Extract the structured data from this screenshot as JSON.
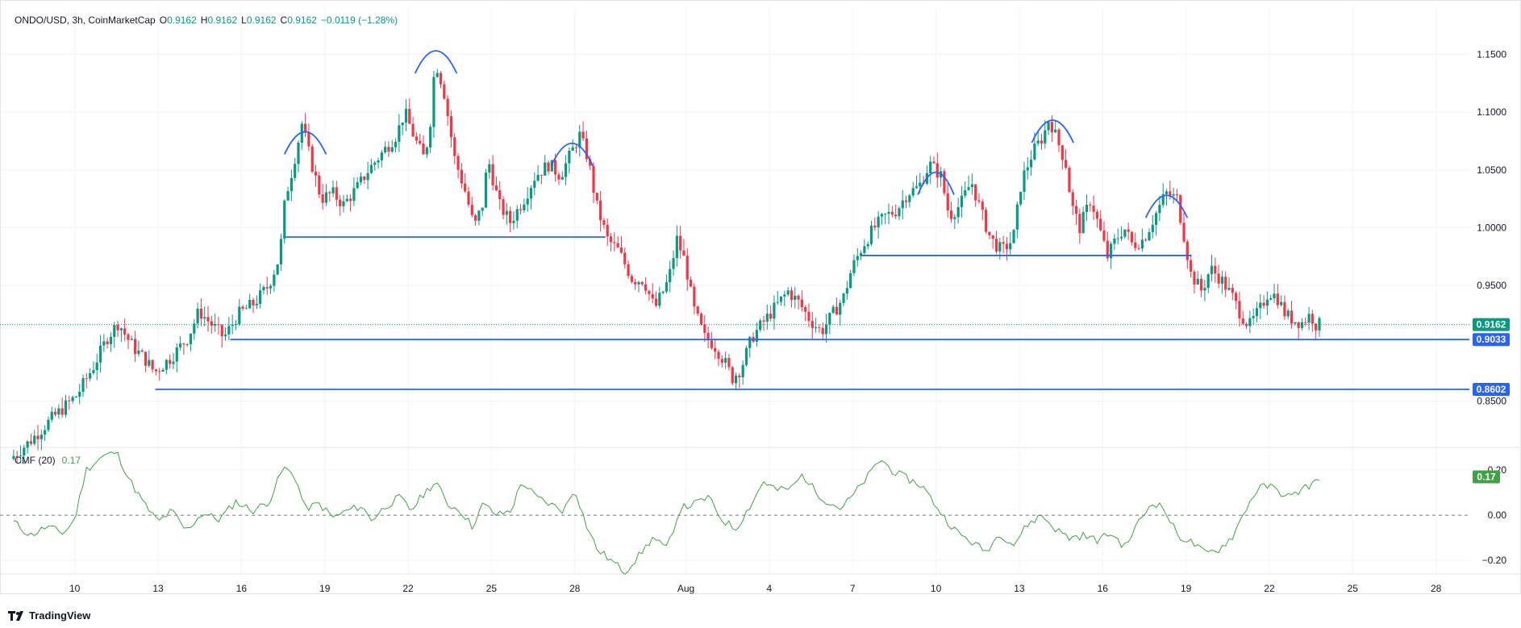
{
  "header": {
    "symbol": "ONDO/USD, 3h, CoinMarketCap",
    "o_label": "O",
    "o_value": "0.9162",
    "h_label": "H",
    "h_value": "0.9162",
    "l_label": "L",
    "l_value": "0.9162",
    "c_label": "C",
    "c_value": "0.9162",
    "change": "−0.0119 (−1.28%)"
  },
  "indicator": {
    "name": "CMF (20)",
    "value": "0.17"
  },
  "brand": "TradingView",
  "colors": {
    "up": "#089981",
    "down": "#f23645",
    "level": "#2962ff",
    "arc": "#2962ff",
    "cmf": "#43a047",
    "price_line": "#089981"
  },
  "chart_data": [
    {
      "type": "candlestick",
      "title": "ONDO/USD, 3h, CoinMarketCap",
      "x_tick_labels": [
        "10",
        "13",
        "16",
        "19",
        "22",
        "25",
        "28",
        "Aug",
        "4",
        "7",
        "10",
        "13",
        "16",
        "19",
        "22",
        "25",
        "28"
      ],
      "x_tick_days": [
        10,
        13,
        16,
        19,
        22,
        25,
        28,
        32,
        35,
        38,
        41,
        44,
        47,
        50,
        53,
        56,
        59
      ],
      "x_range_days": [
        7.6,
        60.2
      ],
      "y_tick_labels": [
        "0.8500",
        "0.9500",
        "1.0000",
        "1.0500",
        "1.1000",
        "1.1500"
      ],
      "y_range": [
        0.81,
        1.19
      ],
      "grid": true,
      "last_price": "0.9162",
      "price_path": [
        [
          7.8,
          0.8
        ],
        [
          8.5,
          0.815
        ],
        [
          9.3,
          0.835
        ],
        [
          10.2,
          0.855
        ],
        [
          10.8,
          0.88
        ],
        [
          11.3,
          0.905
        ],
        [
          11.7,
          0.918
        ],
        [
          12.0,
          0.905
        ],
        [
          12.3,
          0.895
        ],
        [
          12.7,
          0.885
        ],
        [
          13.0,
          0.875
        ],
        [
          13.6,
          0.888
        ],
        [
          14.2,
          0.905
        ],
        [
          14.6,
          0.928
        ],
        [
          15.1,
          0.915
        ],
        [
          15.5,
          0.905
        ],
        [
          16.0,
          0.925
        ],
        [
          16.6,
          0.935
        ],
        [
          17.1,
          0.95
        ],
        [
          17.5,
          0.975
        ],
        [
          17.7,
          1.025
        ],
        [
          18.0,
          1.055
        ],
        [
          18.3,
          1.09
        ],
        [
          18.6,
          1.06
        ],
        [
          19.0,
          1.025
        ],
        [
          19.4,
          1.03
        ],
        [
          19.8,
          1.02
        ],
        [
          20.3,
          1.035
        ],
        [
          20.7,
          1.05
        ],
        [
          21.2,
          1.065
        ],
        [
          21.7,
          1.08
        ],
        [
          22.0,
          1.1
        ],
        [
          22.4,
          1.075
        ],
        [
          22.7,
          1.06
        ],
        [
          22.9,
          1.085
        ],
        [
          23.1,
          1.145
        ],
        [
          23.4,
          1.12
        ],
        [
          23.8,
          1.06
        ],
        [
          24.2,
          1.03
        ],
        [
          24.5,
          1.0
        ],
        [
          24.8,
          1.02
        ],
        [
          25.0,
          1.06
        ],
        [
          25.4,
          1.02
        ],
        [
          25.8,
          1.005
        ],
        [
          26.3,
          1.025
        ],
        [
          26.7,
          1.045
        ],
        [
          27.2,
          1.055
        ],
        [
          27.6,
          1.045
        ],
        [
          28.0,
          1.065
        ],
        [
          28.3,
          1.08
        ],
        [
          28.6,
          1.06
        ],
        [
          28.9,
          1.02
        ],
        [
          29.3,
          0.99
        ],
        [
          29.7,
          0.98
        ],
        [
          30.2,
          0.955
        ],
        [
          30.6,
          0.955
        ],
        [
          31.0,
          0.93
        ],
        [
          31.5,
          0.955
        ],
        [
          31.8,
          0.99
        ],
        [
          32.1,
          0.97
        ],
        [
          32.4,
          0.93
        ],
        [
          32.8,
          0.905
        ],
        [
          33.1,
          0.9
        ],
        [
          33.5,
          0.885
        ],
        [
          33.8,
          0.87
        ],
        [
          34.1,
          0.878
        ],
        [
          34.5,
          0.905
        ],
        [
          34.9,
          0.918
        ],
        [
          35.3,
          0.93
        ],
        [
          35.8,
          0.945
        ],
        [
          36.2,
          0.935
        ],
        [
          36.6,
          0.92
        ],
        [
          37.0,
          0.91
        ],
        [
          37.4,
          0.925
        ],
        [
          37.8,
          0.94
        ],
        [
          38.1,
          0.965
        ],
        [
          38.5,
          0.985
        ],
        [
          38.9,
          1.0
        ],
        [
          39.3,
          1.01
        ],
        [
          39.7,
          1.015
        ],
        [
          40.1,
          1.03
        ],
        [
          40.5,
          1.035
        ],
        [
          40.9,
          1.055
        ],
        [
          41.3,
          1.045
        ],
        [
          41.6,
          1.01
        ],
        [
          42.0,
          1.02
        ],
        [
          42.4,
          1.04
        ],
        [
          42.8,
          1.01
        ],
        [
          43.1,
          0.99
        ],
        [
          43.5,
          0.98
        ],
        [
          43.9,
          0.99
        ],
        [
          44.2,
          1.04
        ],
        [
          44.6,
          1.065
        ],
        [
          45.0,
          1.08
        ],
        [
          45.2,
          1.095
        ],
        [
          45.5,
          1.075
        ],
        [
          45.8,
          1.055
        ],
        [
          46.0,
          1.02
        ],
        [
          46.3,
          1.0
        ],
        [
          46.7,
          1.025
        ],
        [
          47.0,
          1.0
        ],
        [
          47.3,
          0.975
        ],
        [
          47.6,
          0.99
        ],
        [
          47.9,
          1.0
        ],
        [
          48.2,
          0.985
        ],
        [
          48.6,
          0.99
        ],
        [
          49.0,
          1.01
        ],
        [
          49.4,
          1.03
        ],
        [
          49.8,
          1.025
        ],
        [
          50.0,
          1.0
        ],
        [
          50.3,
          0.96
        ],
        [
          50.7,
          0.945
        ],
        [
          51.0,
          0.965
        ],
        [
          51.4,
          0.955
        ],
        [
          51.8,
          0.94
        ],
        [
          52.1,
          0.925
        ],
        [
          52.4,
          0.915
        ],
        [
          52.8,
          0.93
        ],
        [
          53.1,
          0.945
        ],
        [
          53.4,
          0.94
        ],
        [
          53.7,
          0.925
        ],
        [
          54.0,
          0.92
        ],
        [
          54.3,
          0.918
        ],
        [
          54.6,
          0.925
        ],
        [
          54.8,
          0.9162
        ]
      ],
      "levels": [
        {
          "label": "0.9033",
          "value": 0.9033,
          "from_day": 15.6,
          "extend_to_axis": true
        },
        {
          "label": "0.8602",
          "value": 0.8602,
          "from_day": 12.9,
          "extend_to_axis": true
        },
        {
          "value": 0.992,
          "from_day": 17.6,
          "to_day": 29.1
        },
        {
          "value": 0.976,
          "from_day": 38.3,
          "to_day": 50.2
        }
      ],
      "pattern_tops": [
        {
          "day": 18.3,
          "value": 1.09,
          "width": 1.5
        },
        {
          "day": 23.0,
          "value": 1.16,
          "width": 1.5
        },
        {
          "day": 27.9,
          "value": 1.08,
          "width": 1.5
        },
        {
          "day": 41.0,
          "value": 1.055,
          "width": 1.3
        },
        {
          "day": 45.2,
          "value": 1.1,
          "width": 1.5
        },
        {
          "day": 49.3,
          "value": 1.035,
          "width": 1.5
        }
      ]
    },
    {
      "type": "line",
      "series_label": "CMF (20)",
      "y_tick_labels": [
        "0.20",
        "0.00",
        "−0.20"
      ],
      "y_range": [
        -0.26,
        0.3
      ],
      "zero_line": true,
      "last_value": "0.17",
      "path": [
        [
          7.8,
          -0.03
        ],
        [
          8.4,
          -0.09
        ],
        [
          9.0,
          -0.05
        ],
        [
          9.6,
          -0.08
        ],
        [
          10.0,
          -0.02
        ],
        [
          10.4,
          0.2
        ],
        [
          11.0,
          0.26
        ],
        [
          11.5,
          0.28
        ],
        [
          12.0,
          0.15
        ],
        [
          12.5,
          0.05
        ],
        [
          13.0,
          -0.03
        ],
        [
          13.5,
          0.02
        ],
        [
          14.0,
          -0.07
        ],
        [
          14.6,
          0.01
        ],
        [
          15.2,
          -0.02
        ],
        [
          15.8,
          0.06
        ],
        [
          16.4,
          0.02
        ],
        [
          17.0,
          0.06
        ],
        [
          17.5,
          0.21
        ],
        [
          17.9,
          0.18
        ],
        [
          18.3,
          0.03
        ],
        [
          18.8,
          0.05
        ],
        [
          19.3,
          -0.01
        ],
        [
          19.8,
          0.02
        ],
        [
          20.3,
          0.04
        ],
        [
          20.7,
          -0.02
        ],
        [
          21.2,
          0.04
        ],
        [
          21.7,
          0.08
        ],
        [
          22.1,
          0.02
        ],
        [
          22.6,
          0.1
        ],
        [
          23.0,
          0.15
        ],
        [
          23.4,
          0.05
        ],
        [
          23.9,
          0.02
        ],
        [
          24.3,
          -0.05
        ],
        [
          24.7,
          0.05
        ],
        [
          25.2,
          0.0
        ],
        [
          25.7,
          0.02
        ],
        [
          26.1,
          0.15
        ],
        [
          26.6,
          0.08
        ],
        [
          27.1,
          0.05
        ],
        [
          27.6,
          0.02
        ],
        [
          28.0,
          0.12
        ],
        [
          28.4,
          -0.04
        ],
        [
          28.8,
          -0.15
        ],
        [
          29.3,
          -0.2
        ],
        [
          29.8,
          -0.25
        ],
        [
          30.3,
          -0.18
        ],
        [
          30.8,
          -0.1
        ],
        [
          31.3,
          -0.15
        ],
        [
          31.8,
          0.03
        ],
        [
          32.3,
          0.05
        ],
        [
          32.8,
          0.08
        ],
        [
          33.3,
          -0.02
        ],
        [
          33.8,
          -0.06
        ],
        [
          34.3,
          0.04
        ],
        [
          34.8,
          0.15
        ],
        [
          35.3,
          0.11
        ],
        [
          35.8,
          0.12
        ],
        [
          36.2,
          0.18
        ],
        [
          36.7,
          0.1
        ],
        [
          37.1,
          0.06
        ],
        [
          37.6,
          0.03
        ],
        [
          38.1,
          0.1
        ],
        [
          38.6,
          0.18
        ],
        [
          39.0,
          0.25
        ],
        [
          39.5,
          0.19
        ],
        [
          40.0,
          0.16
        ],
        [
          40.5,
          0.13
        ],
        [
          40.9,
          0.06
        ],
        [
          41.3,
          -0.01
        ],
        [
          41.8,
          -0.08
        ],
        [
          42.3,
          -0.12
        ],
        [
          42.8,
          -0.16
        ],
        [
          43.3,
          -0.08
        ],
        [
          43.8,
          -0.13
        ],
        [
          44.3,
          -0.04
        ],
        [
          44.8,
          0.0
        ],
        [
          45.3,
          -0.06
        ],
        [
          45.8,
          -0.1
        ],
        [
          46.3,
          -0.09
        ],
        [
          46.8,
          -0.11
        ],
        [
          47.3,
          -0.08
        ],
        [
          47.8,
          -0.14
        ],
        [
          48.3,
          -0.03
        ],
        [
          48.8,
          0.06
        ],
        [
          49.2,
          0.03
        ],
        [
          49.7,
          -0.09
        ],
        [
          50.2,
          -0.12
        ],
        [
          50.7,
          -0.17
        ],
        [
          51.2,
          -0.15
        ],
        [
          51.7,
          -0.09
        ],
        [
          52.2,
          0.04
        ],
        [
          52.6,
          0.12
        ],
        [
          53.0,
          0.13
        ],
        [
          53.4,
          0.1
        ],
        [
          53.8,
          0.08
        ],
        [
          54.2,
          0.12
        ],
        [
          54.6,
          0.14
        ],
        [
          54.8,
          0.17
        ]
      ]
    }
  ]
}
